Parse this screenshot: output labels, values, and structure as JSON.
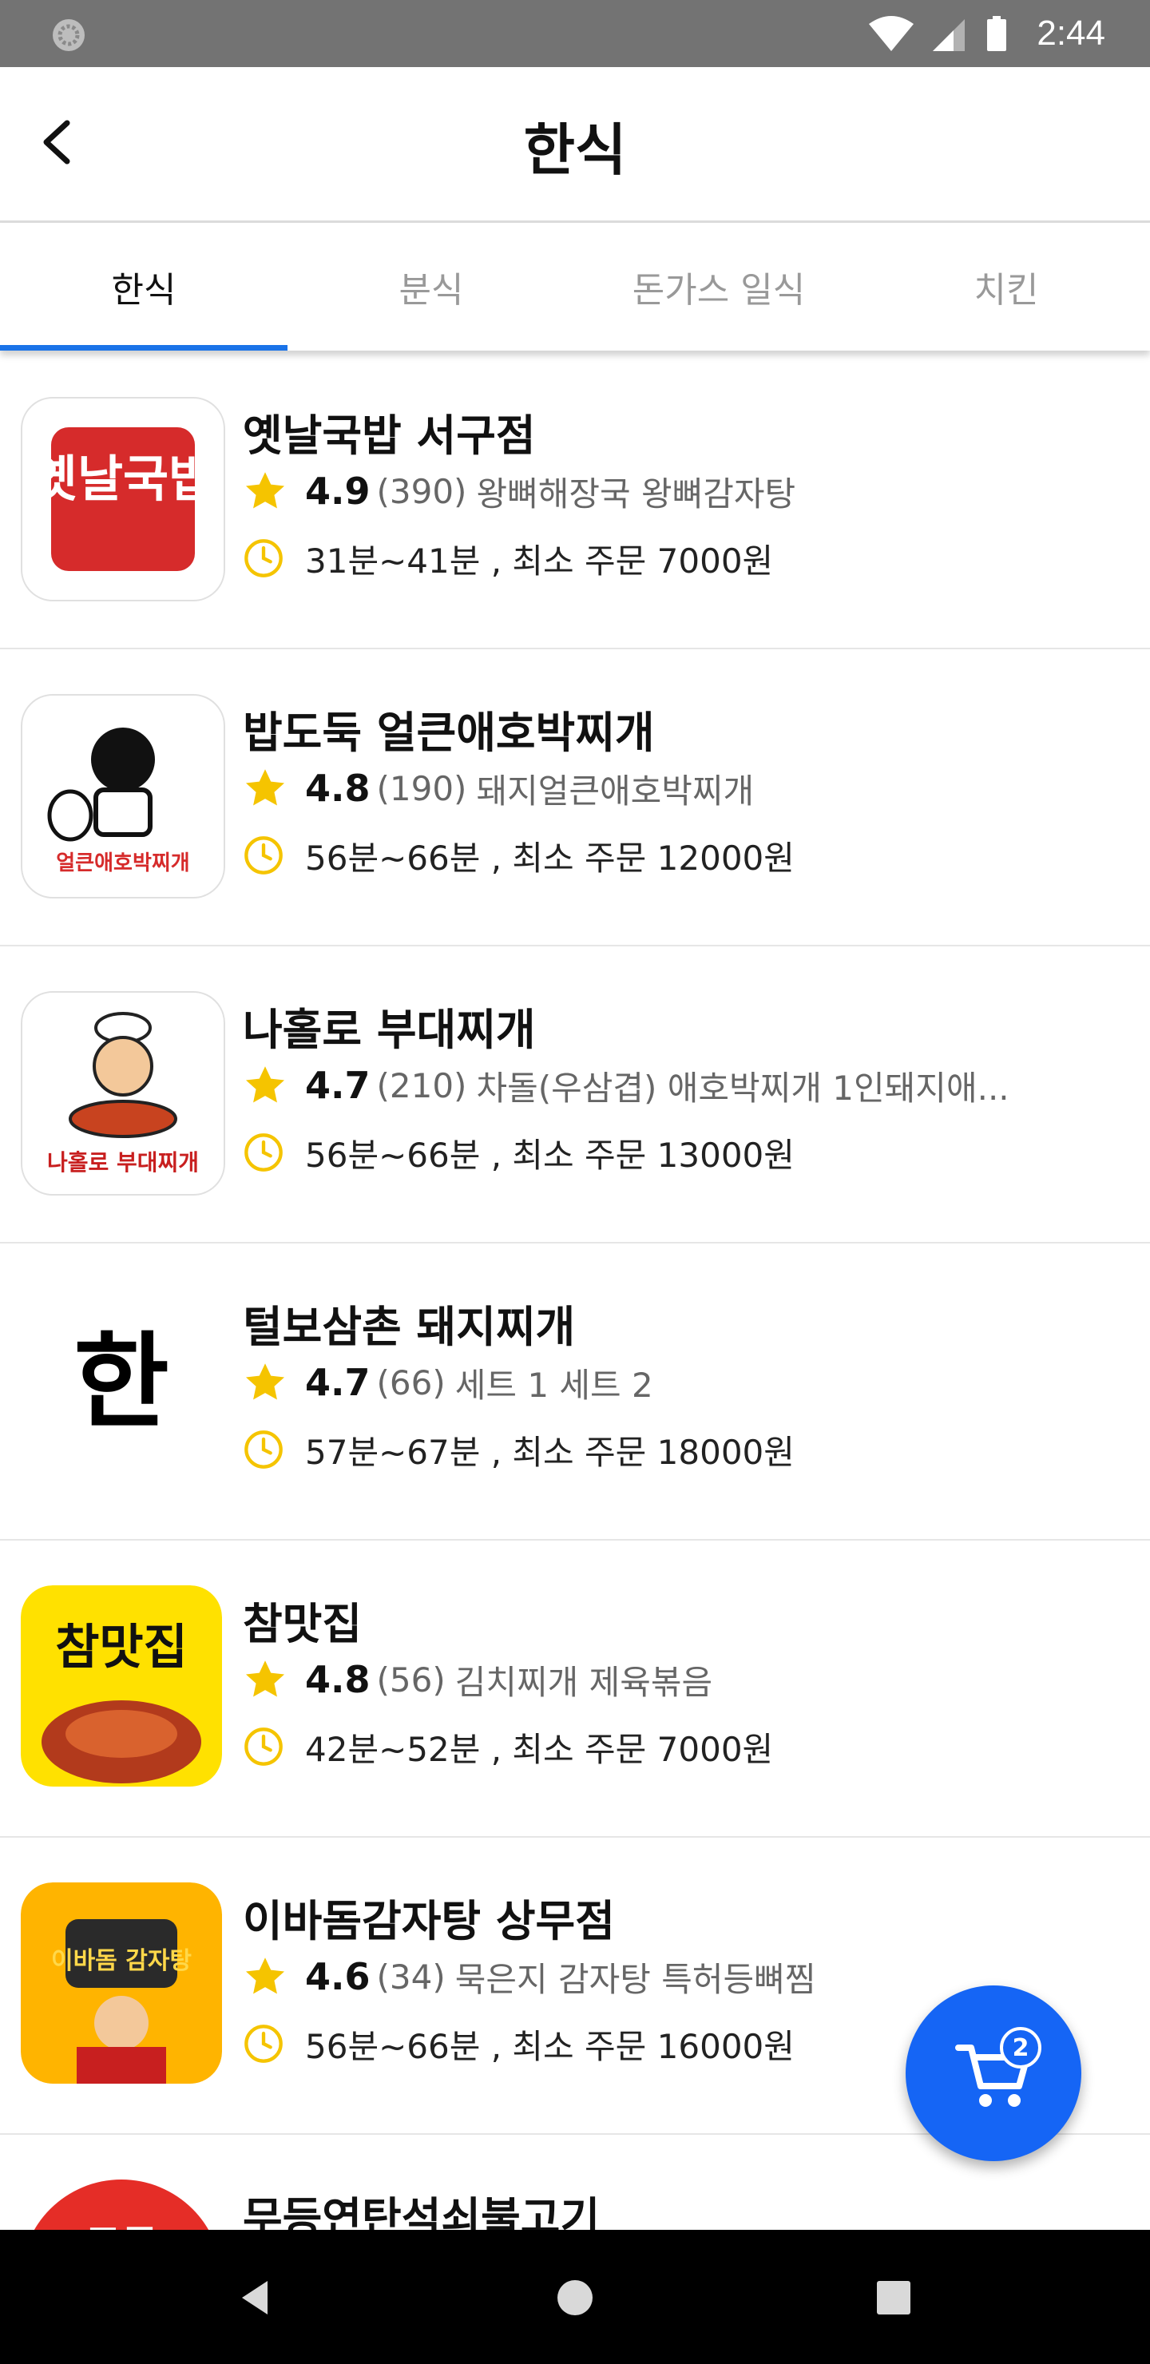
{
  "status_bar": {
    "time": "2:44",
    "icons": [
      "loading-icon",
      "wifi-icon",
      "signal-icon",
      "battery-icon"
    ]
  },
  "app_bar": {
    "title": "한식",
    "back_icon": "back-arrow-icon"
  },
  "tabs": [
    {
      "label": "한식",
      "active": true
    },
    {
      "label": "분식",
      "active": false
    },
    {
      "label": "돈가스 일식",
      "active": false
    },
    {
      "label": "치킨",
      "active": false
    }
  ],
  "restaurants": [
    {
      "name": "옛날국밥 서구점",
      "rating": "4.9",
      "review_count": "(390)",
      "menu": "왕뼈해장국  왕뼈감자탕",
      "delivery": "31분~41분 , 최소 주문 7000원",
      "logo_text": "옛날국밥"
    },
    {
      "name": "밥도둑 얼큰애호박찌개",
      "rating": "4.8",
      "review_count": "(190)",
      "menu": "돼지얼큰애호박찌개",
      "delivery": "56분~66분 , 최소 주문 12000원",
      "logo_text": "얼큰애호박찌개"
    },
    {
      "name": "나홀로 부대찌개",
      "rating": "4.7",
      "review_count": "(210)",
      "menu": "차돌(우삼겹) 애호박찌개  1인돼지애...",
      "delivery": "56분~66분 , 최소 주문 13000원",
      "logo_text": "나홀로 부대찌개"
    },
    {
      "name": "털보삼촌 돼지찌개",
      "rating": "4.7",
      "review_count": "(66)",
      "menu": "세트 1  세트 2",
      "delivery": "57분~67분 , 최소 주문 18000원",
      "logo_text": "한"
    },
    {
      "name": "참맛집",
      "rating": "4.8",
      "review_count": "(56)",
      "menu": "김치찌개  제육볶음",
      "delivery": "42분~52분 , 최소 주문 7000원",
      "logo_text": "참맛집"
    },
    {
      "name": "이바돔감자탕 상무점",
      "rating": "4.6",
      "review_count": "(34)",
      "menu": "묵은지 감자탕  특허등뼈찜",
      "delivery": "56분~66분 , 최소 주문 16000원",
      "logo_text": "이바돔 감자탕"
    },
    {
      "name": "무등연탄석쇠불고기",
      "rating": "",
      "review_count": "",
      "menu": "",
      "delivery": "",
      "logo_text": "무등"
    }
  ],
  "cart": {
    "count": "2",
    "icon": "cart-icon"
  },
  "colors": {
    "accent": "#1a73e8",
    "fab": "#1565f5",
    "star": "#f5c400",
    "status_bar": "#737373"
  }
}
